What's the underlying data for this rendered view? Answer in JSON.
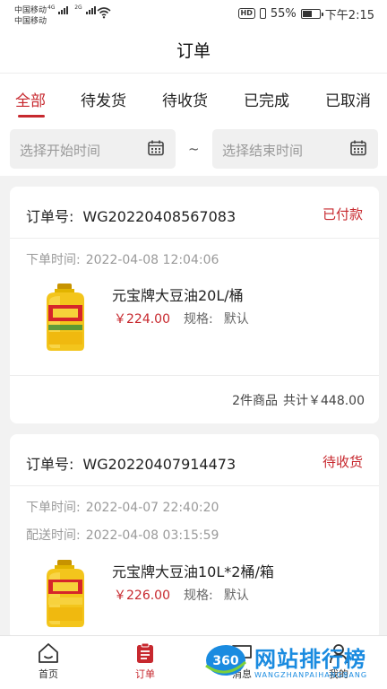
{
  "status_bar": {
    "carrier_1": "中国移动",
    "net_1": "4G",
    "carrier_2": "中国移动",
    "net_2": "2G",
    "hd": "HD",
    "battery": "55%",
    "time": "下午2:15"
  },
  "header": {
    "title": "订单"
  },
  "tabs": [
    {
      "label": "全部",
      "active": true
    },
    {
      "label": "待发货",
      "active": false
    },
    {
      "label": "待收货",
      "active": false
    },
    {
      "label": "已完成",
      "active": false
    },
    {
      "label": "已取消",
      "active": false
    }
  ],
  "filter": {
    "start_placeholder": "选择开始时间",
    "separator": "~",
    "end_placeholder": "选择结束时间"
  },
  "orders": [
    {
      "number_label": "订单号:",
      "number": "WG20220408567083",
      "status": "已付款",
      "meta": [
        {
          "label": "下单时间:",
          "value": "2022-04-08 12:04:06"
        }
      ],
      "product": {
        "name": "元宝牌大豆油20L/桶",
        "price": "￥224.00",
        "spec_label": "规格:",
        "spec_value": "默认"
      },
      "count_text": "2件商品",
      "total_text": "共计￥448.00"
    },
    {
      "number_label": "订单号:",
      "number": "WG20220407914473",
      "status": "待收货",
      "meta": [
        {
          "label": "下单时间:",
          "value": "2022-04-07 22:40:20"
        },
        {
          "label": "配送时间:",
          "value": "2022-04-08 03:15:59"
        }
      ],
      "product": {
        "name": "元宝牌大豆油10L*2桶/箱",
        "price": "￥226.00",
        "spec_label": "规格:",
        "spec_value": "默认"
      }
    }
  ],
  "bottom_nav": [
    {
      "label": "首页",
      "icon": "home-icon",
      "active": false
    },
    {
      "label": "订单",
      "icon": "order-icon",
      "active": true
    },
    {
      "label": "消息",
      "icon": "message-icon",
      "active": false
    },
    {
      "label": "我的",
      "icon": "user-icon",
      "active": false
    }
  ],
  "watermark": {
    "text": "网站排行榜",
    "sub": "WANGZHANPAIHANGBANG",
    "logo": "360"
  },
  "colors": {
    "accent": "#c7282e",
    "background": "#f2f2f2",
    "muted": "#9a9a9a",
    "watermark": "#1a8be0"
  }
}
